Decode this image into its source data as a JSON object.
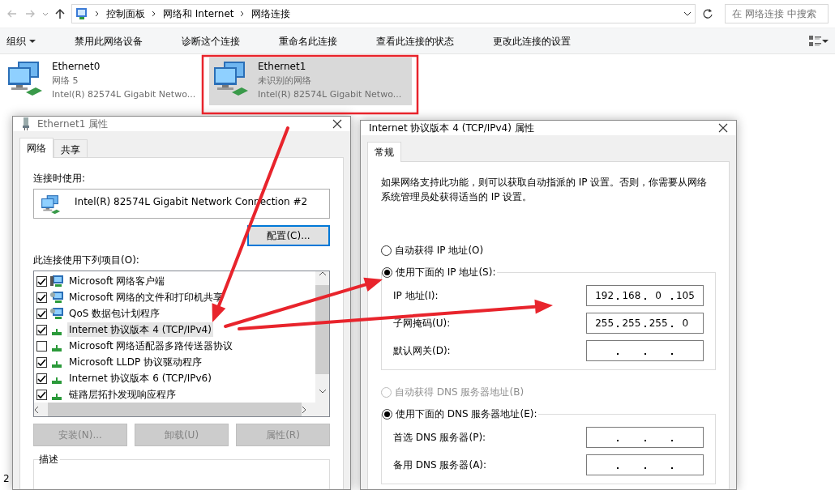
{
  "explorer": {
    "address_path": [
      "控制面板",
      "网络和 Internet",
      "网络连接"
    ],
    "search": {
      "placeholder": "在 网络连接 中搜索"
    },
    "toolbar": [
      {
        "label": "组织",
        "dropdown": true
      },
      {
        "label": "禁用此网络设备",
        "dropdown": false
      },
      {
        "label": "诊断这个连接",
        "dropdown": false
      },
      {
        "label": "重命名此连接",
        "dropdown": false
      },
      {
        "label": "查看此连接的状态",
        "dropdown": false
      },
      {
        "label": "更改此连接的设置",
        "dropdown": false
      }
    ],
    "connections": [
      {
        "name": "Ethernet0",
        "status": "网络 5",
        "adapter": "Intel(R) 82574L Gigabit Netwo...",
        "selected": false
      },
      {
        "name": "Ethernet1",
        "status": "未识别的网络",
        "adapter": "Intel(R) 82574L Gigabit Netwo...",
        "selected": true
      }
    ],
    "status_bar": "2"
  },
  "adapter_dialog": {
    "title": "Ethernet1 属性",
    "tabs": [
      {
        "label": "网络",
        "selected": true
      },
      {
        "label": "共享",
        "selected": false
      }
    ],
    "connect_using_label": "连接时使用:",
    "adapter": "Intel(R) 82574L Gigabit Network Connection #2",
    "configure_button": "配置(C)...",
    "items_label": "此连接使用下列项目(O):",
    "items": [
      {
        "kind": "client",
        "label": "Microsoft 网络客户端",
        "checked": true,
        "selected": false
      },
      {
        "kind": "service",
        "label": "Microsoft 网络的文件和打印机共享",
        "checked": true,
        "selected": false
      },
      {
        "kind": "service",
        "label": "QoS 数据包计划程序",
        "checked": true,
        "selected": false
      },
      {
        "kind": "protocol",
        "label": "Internet 协议版本 4 (TCP/IPv4)",
        "checked": true,
        "selected": true
      },
      {
        "kind": "protocol",
        "label": "Microsoft 网络适配器多路传送器协议",
        "checked": false,
        "selected": false
      },
      {
        "kind": "protocol",
        "label": "Microsoft LLDP 协议驱动程序",
        "checked": true,
        "selected": false
      },
      {
        "kind": "protocol",
        "label": "Internet 协议版本 6 (TCP/IPv6)",
        "checked": true,
        "selected": false
      },
      {
        "kind": "protocol",
        "label": "链路层拓扑发现响应程序",
        "checked": true,
        "selected": false
      }
    ],
    "buttons": [
      {
        "label": "安装(N)...",
        "disabled": true
      },
      {
        "label": "卸载(U)",
        "disabled": true
      },
      {
        "label": "属性(R)",
        "disabled": true
      }
    ],
    "description_label": "描述"
  },
  "ipv4_dialog": {
    "title": "Internet 协议版本 4 (TCP/IPv4) 属性",
    "tabs": [
      {
        "label": "常规",
        "selected": true
      }
    ],
    "intro": "如果网络支持此功能，则可以获取自动指派的 IP 设置。否则，你需要从网络系统管理员处获得适当的 IP 设置。",
    "ip_auto": {
      "label": "自动获得 IP 地址(O)",
      "selected": false,
      "disabled": false
    },
    "ip_manual": {
      "label": "使用下面的 IP 地址(S):",
      "selected": true,
      "disabled": false
    },
    "ip_fields": [
      {
        "label": "IP 地址(I):",
        "octets": [
          "192",
          "168",
          "0",
          "105"
        ]
      },
      {
        "label": "子网掩码(U):",
        "octets": [
          "255",
          "255",
          "255",
          "0"
        ]
      },
      {
        "label": "默认网关(D):"
      }
    ],
    "dns_auto": {
      "label": "自动获得 DNS 服务器地址(B)",
      "selected": false,
      "disabled": true
    },
    "dns_manual": {
      "label": "使用下面的 DNS 服务器地址(E):",
      "selected": true,
      "disabled": false
    },
    "dns_fields": [
      {
        "label": "首选 DNS 服务器(P):"
      },
      {
        "label": "备用 DNS 服务器(A):"
      }
    ]
  }
}
